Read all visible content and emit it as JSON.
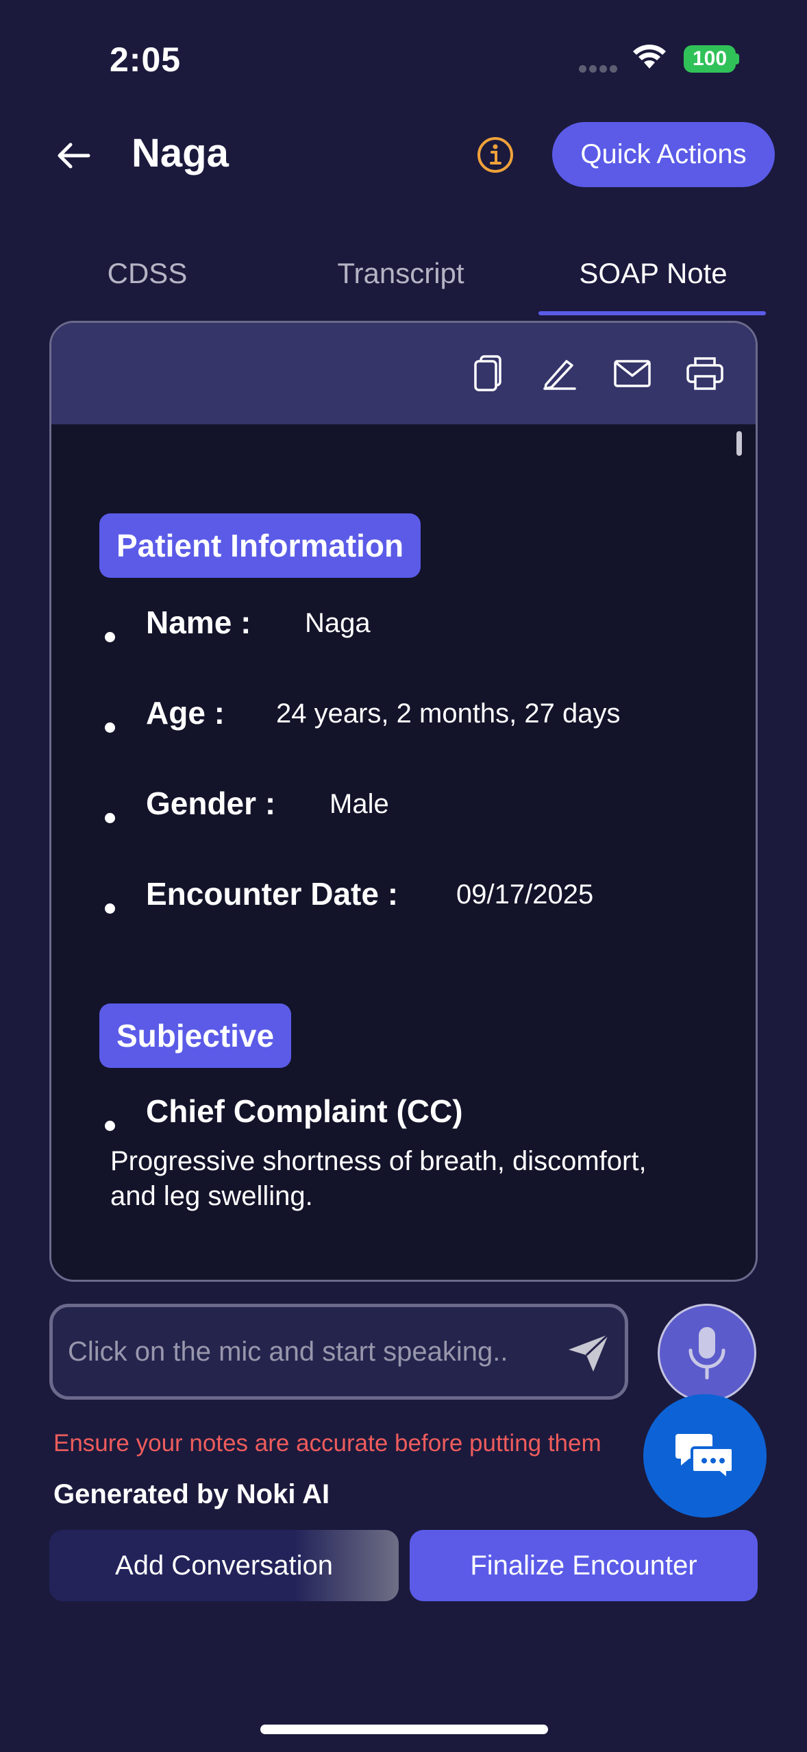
{
  "status_bar": {
    "time": "2:05",
    "battery": "100"
  },
  "header": {
    "title": "Naga",
    "quick_actions_label": "Quick Actions",
    "info_icon_color": "#f0a23a"
  },
  "tabs": [
    {
      "label": "CDSS",
      "active": false
    },
    {
      "label": "Transcript",
      "active": false
    },
    {
      "label": "SOAP Note",
      "active": true
    }
  ],
  "note": {
    "toolbar_icons": [
      "copy-icon",
      "edit-icon",
      "mail-icon",
      "print-icon"
    ],
    "sections": [
      {
        "title": "Patient Information",
        "fields": [
          {
            "label": "Name :",
            "value": "Naga"
          },
          {
            "label": "Age :",
            "value": "24 years, 2 months, 27 days"
          },
          {
            "label": "Gender :",
            "value": "Male"
          },
          {
            "label": "Encounter Date :",
            "value": "09/17/2025"
          }
        ]
      },
      {
        "title": "Subjective",
        "fields": [
          {
            "label": "Chief Complaint (CC)",
            "value": ""
          }
        ],
        "text": "Progressive shortness of breath, discomfort, and leg swelling."
      }
    ]
  },
  "input": {
    "placeholder": "Click on the mic and start speaking.."
  },
  "warning_text": "Ensure your notes are accurate before putting them",
  "generated_by": "Generated by Noki AI",
  "actions": {
    "add_conversation": "Add Conversation",
    "finalize_encounter": "Finalize Encounter"
  },
  "colors": {
    "background": "#1b1a3d",
    "accent": "#5b5be8",
    "warning": "#ef5c5c",
    "chat_fab": "#0d63d6"
  }
}
